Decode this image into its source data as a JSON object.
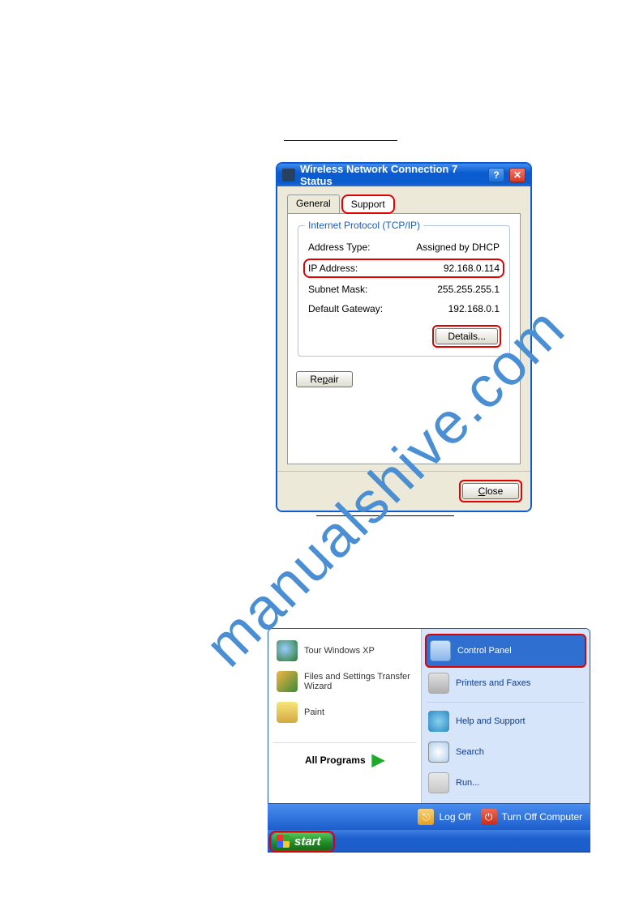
{
  "watermark": "manualshive.com",
  "dialog": {
    "title": "Wireless Network Connection 7 Status",
    "tabs": {
      "general": "General",
      "support": "Support"
    },
    "group_legend": "Internet Protocol (TCP/IP)",
    "rows": {
      "addr_type_label": "Address Type:",
      "addr_type_value": "Assigned by DHCP",
      "ip_label": "IP Address:",
      "ip_value": "92.168.0.114",
      "mask_label": "Subnet Mask:",
      "mask_value": "255.255.255.1",
      "gw_label": "Default Gateway:",
      "gw_value": "192.168.0.1"
    },
    "details_btn": "Details...",
    "repair_btn": "Repair",
    "close_btn": "Close"
  },
  "startmenu": {
    "left": {
      "tour": "Tour Windows XP",
      "transfer": "Files and Settings Transfer Wizard",
      "paint": "Paint",
      "all_programs": "All Programs"
    },
    "right": {
      "control_panel": "Control Panel",
      "printers": "Printers and Faxes",
      "help": "Help and Support",
      "search": "Search",
      "run": "Run..."
    },
    "footer": {
      "logoff": "Log Off",
      "turnoff": "Turn Off Computer"
    },
    "start": "start"
  }
}
